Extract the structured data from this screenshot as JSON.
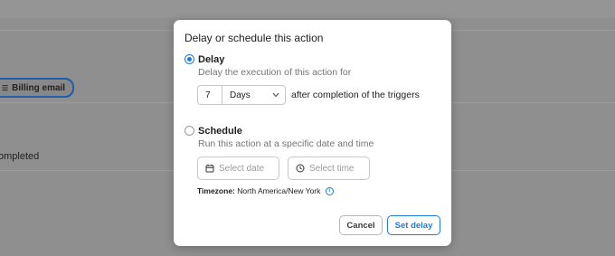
{
  "background": {
    "chip_label": "Billing email",
    "status_text": "ompleted"
  },
  "modal": {
    "title": "Delay or schedule this action",
    "delay": {
      "label": "Delay",
      "description": "Delay the execution of this action for",
      "amount": "7",
      "unit": "Days",
      "after_text": "after completion of the triggers",
      "selected": true
    },
    "schedule": {
      "label": "Schedule",
      "description": "Run this action at a specific date and time",
      "date_placeholder": "Select date",
      "time_placeholder": "Select time",
      "selected": false
    },
    "timezone": {
      "label": "Timezone:",
      "value": "North America/New York"
    },
    "buttons": {
      "cancel": "Cancel",
      "set_delay": "Set delay"
    }
  },
  "colors": {
    "accent": "#1e7bd6",
    "overlay": "#8f8f8f"
  }
}
